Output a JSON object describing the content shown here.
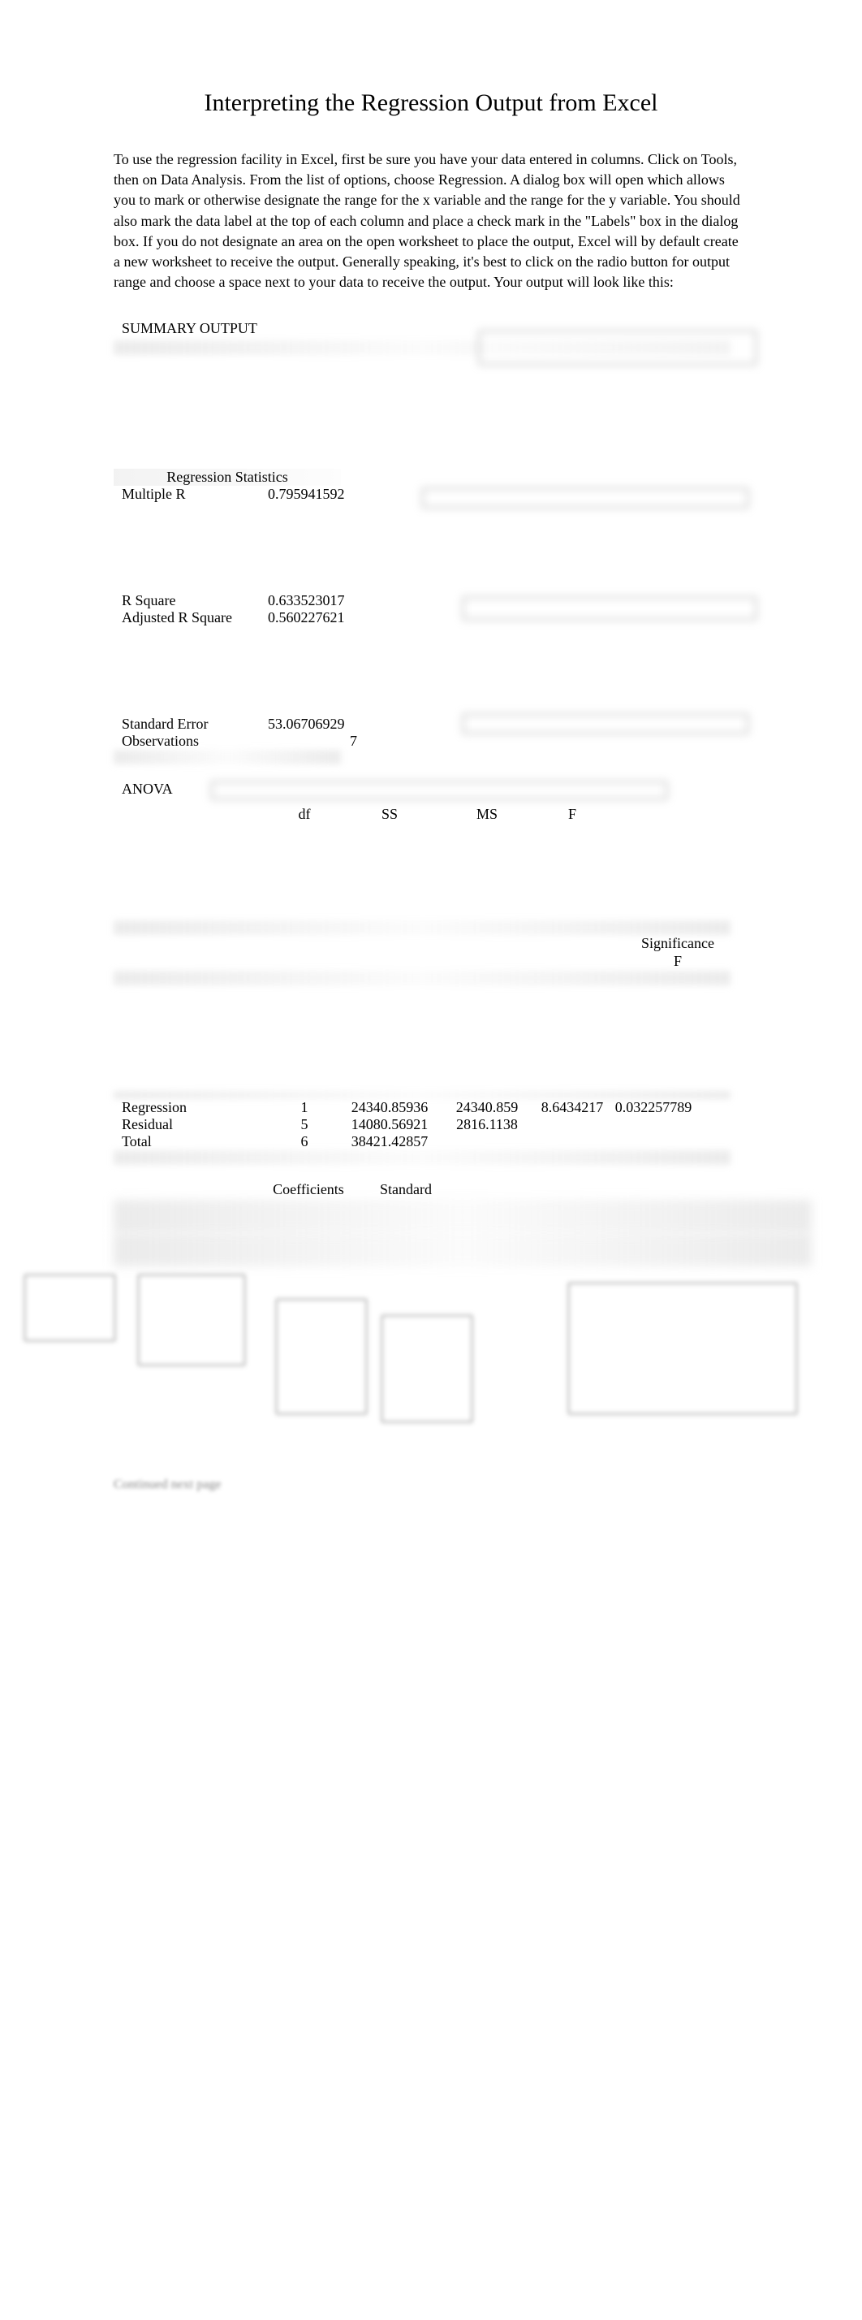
{
  "title": "Interpreting the Regression Output from Excel",
  "intro": "To use the regression facility in Excel, first be sure you have your data entered in columns.  Click on Tools, then on Data Analysis.  From the list of options, choose Regression.  A dialog box will open which allows you to mark or otherwise designate the range for the x variable and the range for the y variable.  You should also mark the data label at the top of each column and place a check mark in the \"Labels\" box in the dialog box.  If you do not designate an area on the open worksheet to place the output, Excel will by default create a new worksheet to receive the output.  Generally speaking, it's best to click on the radio button for output range and choose a space next to your data to receive the output.  Your output will look like this:",
  "summary_output": "SUMMARY OUTPUT",
  "reg_stats_header": "Regression Statistics",
  "stats": {
    "multiple_r_lbl": "Multiple R",
    "multiple_r_val": "0.795941592",
    "r_square_lbl": "R Square",
    "r_square_val": "0.633523017",
    "adj_r_square_lbl": "Adjusted R Square",
    "adj_r_square_val": "0.560227621",
    "std_error_lbl": "Standard Error",
    "std_error_val": "53.06706929",
    "observations_lbl": "Observations",
    "observations_val": "7"
  },
  "anova_lbl": "ANOVA",
  "anova_headers": {
    "df": "df",
    "ss": "SS",
    "ms": "MS",
    "f": "F",
    "sigf1": "Significance",
    "sigf2": "F"
  },
  "anova_rows": [
    {
      "name": "Regression",
      "df": "1",
      "ss": "24340.85936",
      "ms": "24340.859",
      "f": "8.6434217",
      "sigf": "0.032257789"
    },
    {
      "name": "Residual",
      "df": "5",
      "ss": "14080.56921",
      "ms": "2816.1138",
      "f": "",
      "sigf": ""
    },
    {
      "name": "Total",
      "df": "6",
      "ss": "38421.42857",
      "ms": "",
      "f": "",
      "sigf": ""
    }
  ],
  "coef_headers": {
    "coefficients": "Coefficients",
    "std_error": "Standard"
  },
  "footer": "Continued next page"
}
